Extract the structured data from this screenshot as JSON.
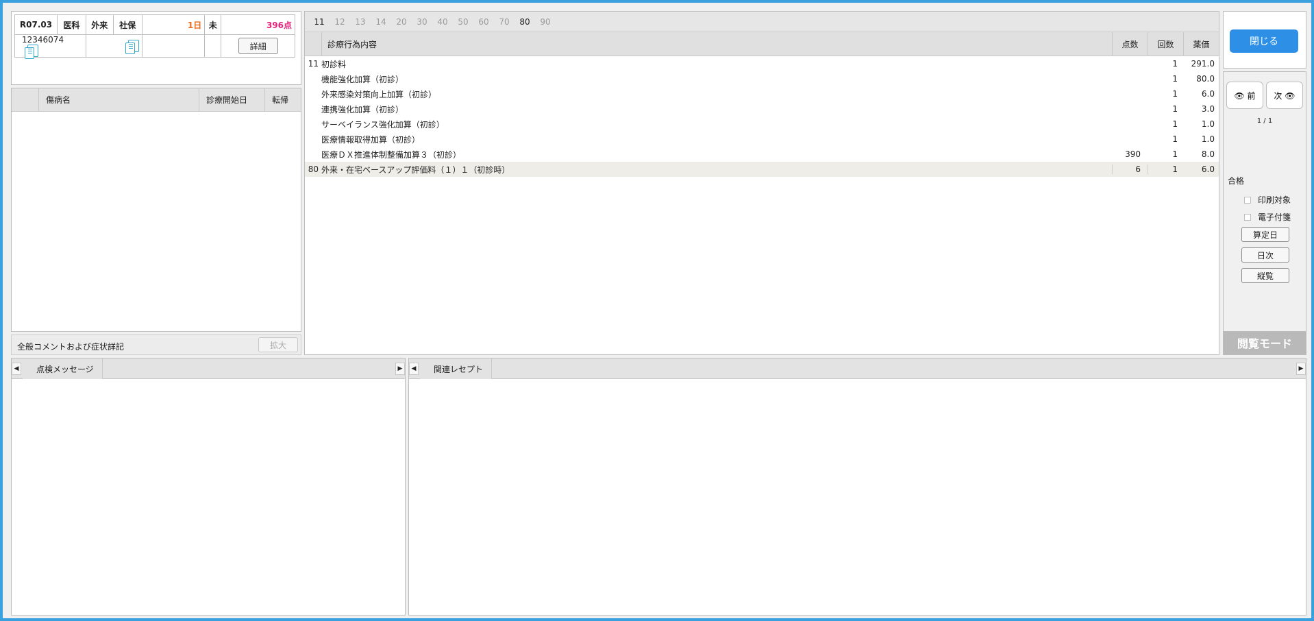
{
  "header": {
    "era": "R07.03",
    "type1": "医科",
    "type2": "外来",
    "insurance": "社保",
    "days": "1日",
    "mi": "未",
    "points": "396点",
    "patient_id": "12346074",
    "detail_btn": "詳細"
  },
  "disease": {
    "columns": [
      "傷病名",
      "診療開始日",
      "転帰"
    ]
  },
  "comment": {
    "label": "全般コメントおよび症状詳記",
    "expand": "拡大"
  },
  "treat": {
    "tabs": [
      "11",
      "12",
      "13",
      "14",
      "20",
      "30",
      "40",
      "50",
      "60",
      "70",
      "80",
      "90"
    ],
    "active_tabs": [
      "11",
      "80"
    ],
    "columns": {
      "content": "診療行為内容",
      "points": "点数",
      "count": "回数",
      "price": "薬価"
    },
    "rows": [
      {
        "code": "11",
        "name": "初診料",
        "points": "",
        "count": "1",
        "price": "291.0"
      },
      {
        "code": "",
        "name": "機能強化加算（初診）",
        "points": "",
        "count": "1",
        "price": "80.0"
      },
      {
        "code": "",
        "name": "外来感染対策向上加算（初診）",
        "points": "",
        "count": "1",
        "price": "6.0"
      },
      {
        "code": "",
        "name": "連携強化加算（初診）",
        "points": "",
        "count": "1",
        "price": "3.0"
      },
      {
        "code": "",
        "name": "サーベイランス強化加算（初診）",
        "points": "",
        "count": "1",
        "price": "1.0"
      },
      {
        "code": "",
        "name": "医療情報取得加算（初診）",
        "points": "",
        "count": "1",
        "price": "1.0"
      },
      {
        "code": "",
        "name": "医療ＤＸ推進体制整備加算３（初診）",
        "points": "390",
        "count": "1",
        "price": "8.0"
      },
      {
        "code": "80",
        "name": "外来・在宅ベースアップ評価料（１）１（初診時）",
        "points": "6",
        "count": "1",
        "price": "6.0"
      }
    ]
  },
  "side": {
    "close": "閉じる",
    "prev": "前",
    "next": "次",
    "page": "1 / 1",
    "pass": "合格",
    "print_target": "印刷対象",
    "e_tag": "電子付箋",
    "calc_day": "算定日",
    "daily": "日次",
    "vertical": "縦覧",
    "mode": "閲覧モード"
  },
  "bottom": {
    "left_tab": "点検メッセージ",
    "right_tab": "関連レセプト"
  },
  "colors": {
    "accent": "#2d8fe6",
    "border": "#3aa0de",
    "days": "#ee6a1a",
    "points": "#e4237e"
  }
}
